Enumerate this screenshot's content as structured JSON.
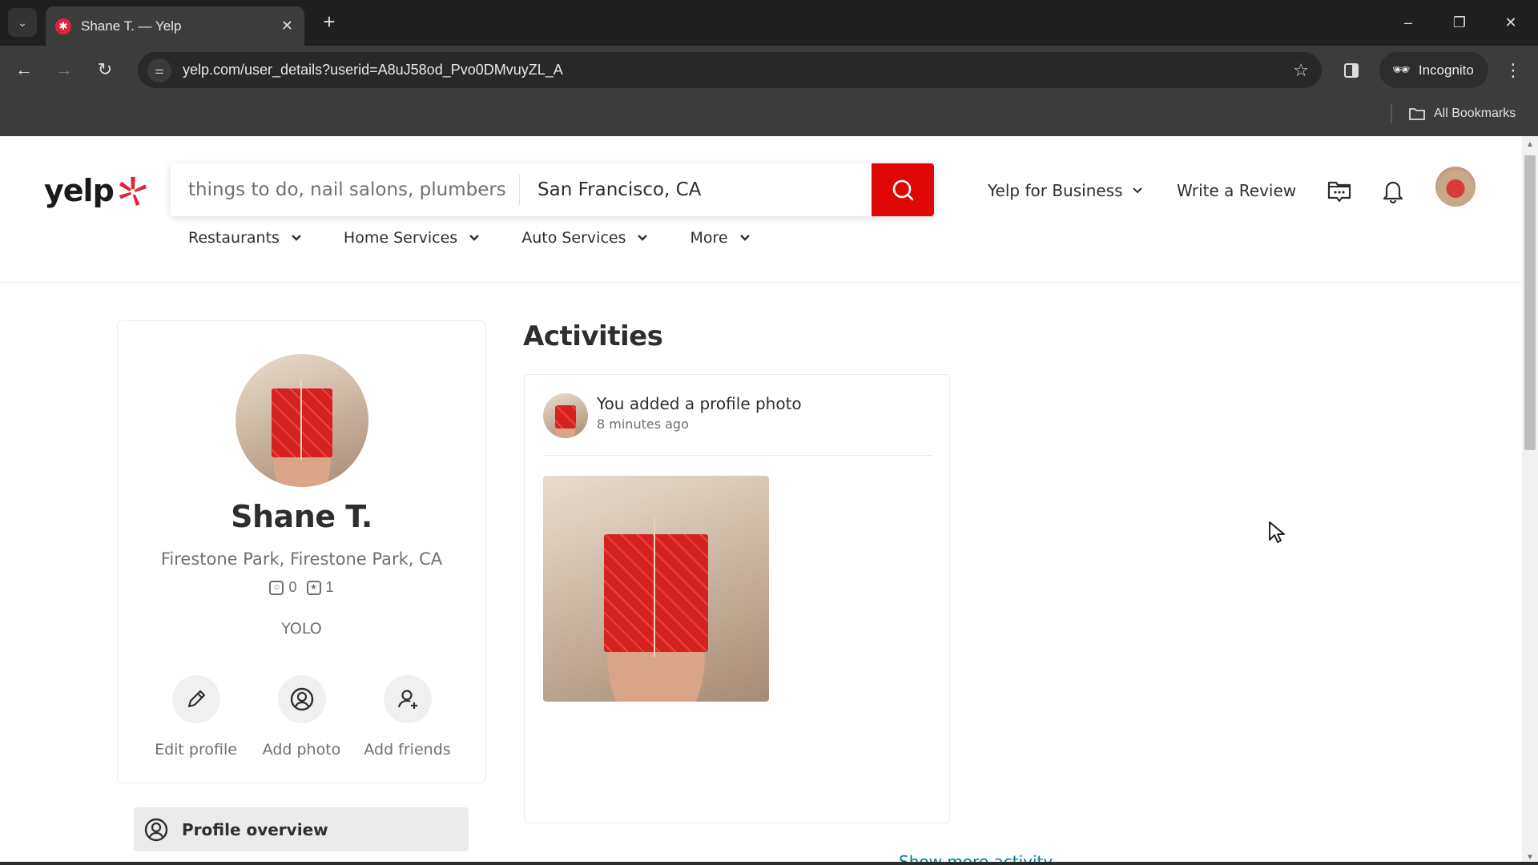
{
  "browser": {
    "tab_title": "Shane T. — Yelp",
    "url": "yelp.com/user_details?userid=A8uJ58od_Pvo0DMvuyZL_A",
    "incognito_label": "Incognito",
    "all_bookmarks_label": "All Bookmarks"
  },
  "header": {
    "logo_text": "yelp",
    "search_placeholder": "things to do, nail salons, plumbers",
    "location_value": "San Francisco, CA",
    "yelp_for_business": "Yelp for Business",
    "write_review": "Write a Review"
  },
  "categories": [
    {
      "label": "Restaurants"
    },
    {
      "label": "Home Services"
    },
    {
      "label": "Auto Services"
    },
    {
      "label": "More"
    }
  ],
  "profile": {
    "name": "Shane T.",
    "location": "Firestone Park, Firestone Park, CA",
    "friends_count": "0",
    "reviews_count": "1",
    "tagline": "YOLO",
    "actions": [
      {
        "label": "Edit profile"
      },
      {
        "label": "Add photo"
      },
      {
        "label": "Add friends"
      }
    ],
    "overview_label": "Profile overview"
  },
  "activities": {
    "title": "Activities",
    "items": [
      {
        "text": "You added a profile photo",
        "time": "8 minutes ago"
      }
    ],
    "show_more": "Show more activity"
  },
  "colors": {
    "brand_red": "#e00707",
    "text_primary": "#2d2e2f",
    "text_secondary": "#6e7072",
    "link": "#027a97"
  }
}
